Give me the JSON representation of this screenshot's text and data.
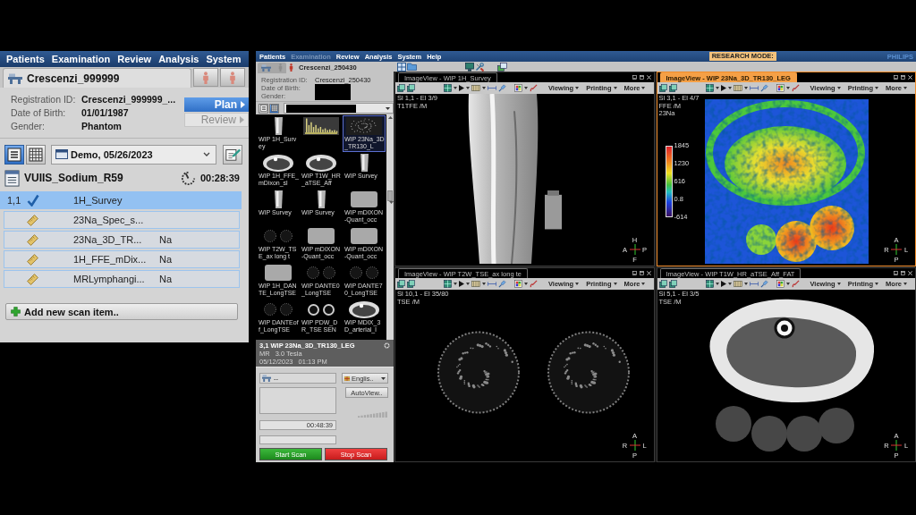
{
  "patient_app": {
    "menu": [
      "Patients",
      "Examination",
      "Review",
      "Analysis",
      "System"
    ],
    "patient_name": "Crescenzi_999999",
    "patient_fields": [
      {
        "label": "Registration ID:",
        "value": "Crescenzi_999999_..."
      },
      {
        "label": "Date of Birth:",
        "value": "01/01/1987"
      },
      {
        "label": "Gender:",
        "value": "Phantom"
      }
    ],
    "mode_buttons": [
      {
        "label": "Plan",
        "selected": true
      },
      {
        "label": "Review",
        "selected": false
      }
    ],
    "view_toggles": [
      {
        "kind": "list",
        "selected": true
      },
      {
        "kind": "grid",
        "selected": false
      }
    ],
    "exam_select": "Demo, 05/26/2023",
    "exam": {
      "title": "VUIIS_Sodium_R59",
      "duration": "00:28:39"
    },
    "scan_items": [
      {
        "index": "1,1",
        "completed": true,
        "name": "1H_Survey",
        "selected": true
      },
      {
        "completed": false,
        "name": "23Na_Spec_s...",
        "selected": false
      },
      {
        "completed": false,
        "name": "23Na_3D_TR...",
        "nucleus": "Na",
        "selected": false
      },
      {
        "completed": false,
        "name": "1H_FFE_mDix...",
        "nucleus": "Na",
        "selected": false
      },
      {
        "completed": false,
        "name": "MRLymphangi...",
        "nucleus": "Na",
        "selected": false
      }
    ],
    "add_button": "Add new scan item.."
  },
  "scanner_app": {
    "menu": [
      {
        "label": "Patients",
        "disabled": false
      },
      {
        "label": "Examination",
        "disabled": true
      },
      {
        "label": "Review",
        "disabled": false
      },
      {
        "label": "Analysis",
        "disabled": false
      },
      {
        "label": "System",
        "disabled": false
      },
      {
        "label": "Help",
        "disabled": false
      }
    ],
    "mode_badge": "RESEARCH MODE:",
    "brand": "PHILIPS",
    "patient_name": "Crescenzi_250430",
    "patient_fields": [
      {
        "label": "Registration ID:",
        "value": "Crescenzi_250430",
        "redacted": false
      },
      {
        "label": "Date of Birth:",
        "redacted": true
      },
      {
        "label": "Gender:",
        "redacted": true
      }
    ],
    "view_toggles": [
      {
        "kind": "list",
        "selected": false
      },
      {
        "kind": "grid",
        "selected": true
      }
    ],
    "series_select": {
      "redacted": true
    },
    "thumbnails": [
      {
        "caption": "WIP 1H_Survey",
        "kind": "coronal",
        "selected": false
      },
      {
        "kind": "spectrum",
        "selected": false
      },
      {
        "caption": "WIP 23Na_3D_TR130_L",
        "kind": "noise",
        "selected": true
      },
      {
        "caption": "WIP 1H_FFE_mDixon_sl",
        "kind": "axial",
        "selected": false
      },
      {
        "caption": "WIP T1W_HR_aTSE_Aff",
        "kind": "axial",
        "selected": false
      },
      {
        "caption": "WIP Survey",
        "kind": "coronal",
        "selected": false
      },
      {
        "caption": "WIP Survey",
        "kind": "coronal",
        "selected": false
      },
      {
        "caption": "WIP Survey",
        "kind": "coronal",
        "selected": false
      },
      {
        "caption": "WIP mDIXON-Quant_occ",
        "kind": "phantom",
        "selected": false
      },
      {
        "caption": "WIP T2W_TSE_ax long t",
        "kind": "dark",
        "selected": false
      },
      {
        "caption": "WIP mDIXON-Quant_occ",
        "kind": "phantom",
        "selected": false
      },
      {
        "caption": "WIP mDIXON-Quant_occ",
        "kind": "phantom",
        "selected": false
      },
      {
        "caption": "WIP 1H_DANTE_LongTSE",
        "kind": "phantom",
        "selected": false
      },
      {
        "caption": "WIP DANTE0_LongTSE",
        "kind": "dark",
        "selected": false
      },
      {
        "caption": "WIP DANTE70_LongTSE",
        "kind": "dark",
        "selected": false
      },
      {
        "caption": "WIP DANTEoff_LongTSE",
        "kind": "dark",
        "selected": false
      },
      {
        "caption": "WIP PDW_DR_TSE SEN",
        "kind": "rings",
        "selected": false
      },
      {
        "caption": "WIP MDIX_3D_arterial_l",
        "kind": "axial",
        "selected": false
      }
    ],
    "selected_series": {
      "title": "3,1 WIP 23Na_3D_TR130_LEG",
      "modality": "MR",
      "field_strength": "3.0 Tesla",
      "date": "05/12/2023",
      "time": "01:13 PM"
    },
    "scan_controls": {
      "coil": "--",
      "language": "Englis..",
      "autoview_button": "AutoView..",
      "remaining_time": "00:48:39",
      "start_button": "Start Scan",
      "stop_button": "Stop Scan"
    },
    "viewers": [
      {
        "title": "ImageView - WIP 1H_Survey",
        "selected": false,
        "menus": [
          "Viewing",
          "Printing",
          "More"
        ],
        "info": [
          "Sl 1,1 - El 3/9",
          "T1TFE /M"
        ],
        "orientation": {
          "top": "H",
          "left": "A",
          "right": "P",
          "bottom": "F"
        },
        "kind": "coronal"
      },
      {
        "title": "ImageView - WIP 23Na_3D_TR130_LEG",
        "selected": true,
        "menus": [
          "Viewing",
          "Printing",
          "More"
        ],
        "info": [
          "Sl 3,1 - El 4/7",
          "FFE /M",
          "23Na"
        ],
        "colorbar": [
          "1845",
          "1230",
          "616",
          "0.8",
          "-614"
        ],
        "orientation": {
          "top": "A",
          "left": "R",
          "right": "L",
          "bottom": "P"
        },
        "kind": "sodium_map"
      },
      {
        "title": "ImageView - WIP T2W_TSE_ax long te",
        "selected": false,
        "menus": [
          "Viewing",
          "Printing",
          "More"
        ],
        "info": [
          "Sl 10,1 - El 35/80",
          "TSE /M"
        ],
        "orientation": {
          "top": "A",
          "left": "R",
          "right": "L",
          "bottom": "P"
        },
        "kind": "axial_pair"
      },
      {
        "title": "ImageView - WIP T1W_HR_aTSE_Aff_FAT",
        "selected": false,
        "menus": [
          "Viewing",
          "Printing",
          "More"
        ],
        "info": [
          "Sl 5,1 - El 3/5",
          "TSE /M"
        ],
        "orientation": {
          "top": "A",
          "left": "R",
          "right": "L",
          "bottom": "P"
        },
        "kind": "axial_t1"
      }
    ]
  }
}
